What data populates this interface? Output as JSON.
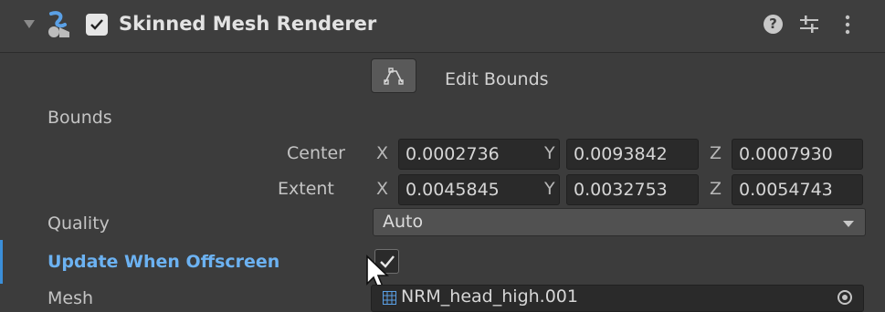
{
  "component": {
    "title": "Skinned Mesh Renderer",
    "enabled": true
  },
  "header_icons": {
    "foldout": "foldout-triangle-icon",
    "component": "skinned-mesh-renderer-icon",
    "help": "help-icon",
    "presets": "presets-sliders-icon",
    "menu": "kebab-menu-icon"
  },
  "edit_bounds": {
    "label": "Edit Bounds",
    "icon": "edit-bounds-icon"
  },
  "bounds": {
    "label": "Bounds",
    "center": {
      "label": "Center",
      "x_axis": "X",
      "x": "0.0002736",
      "y_axis": "Y",
      "y": "0.0093842",
      "z_axis": "Z",
      "z": "0.0007930"
    },
    "extent": {
      "label": "Extent",
      "x_axis": "X",
      "x": "0.0045845",
      "y_axis": "Y",
      "y": "0.0032753",
      "z_axis": "Z",
      "z": "0.0054743"
    }
  },
  "quality": {
    "label": "Quality",
    "value": "Auto"
  },
  "update_when_offscreen": {
    "label": "Update When Offscreen",
    "checked": true,
    "label_color": "#6cb2f2"
  },
  "mesh": {
    "label": "Mesh",
    "value": "NRM_head_high.001"
  }
}
